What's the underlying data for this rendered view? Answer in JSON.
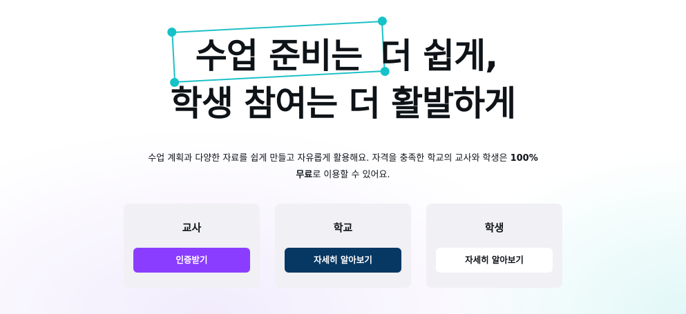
{
  "hero": {
    "headline_highlight": "수업 준비는",
    "headline_line1_rest": "더 쉽게,",
    "headline_line2": "학생 참여는 더 활발하게",
    "subtitle_text": "수업 계획과 다양한 자료를 쉽게 만들고 자유롭게 활용해요. 자격을 충족한 학교의 교사와 학생은 ",
    "subtitle_bold_pct": "100%",
    "subtitle_bold_free": "무료",
    "subtitle_end": "로 이용할 수 있어요."
  },
  "cards": [
    {
      "title": "교사",
      "button_label": "인증받기"
    },
    {
      "title": "학교",
      "button_label": "자세히 알아보기"
    },
    {
      "title": "학생",
      "button_label": "자세히 알아보기"
    }
  ],
  "colors": {
    "accent_purple": "#8b3dff",
    "navy": "#073763",
    "selection_teal": "#1ec0c6"
  }
}
